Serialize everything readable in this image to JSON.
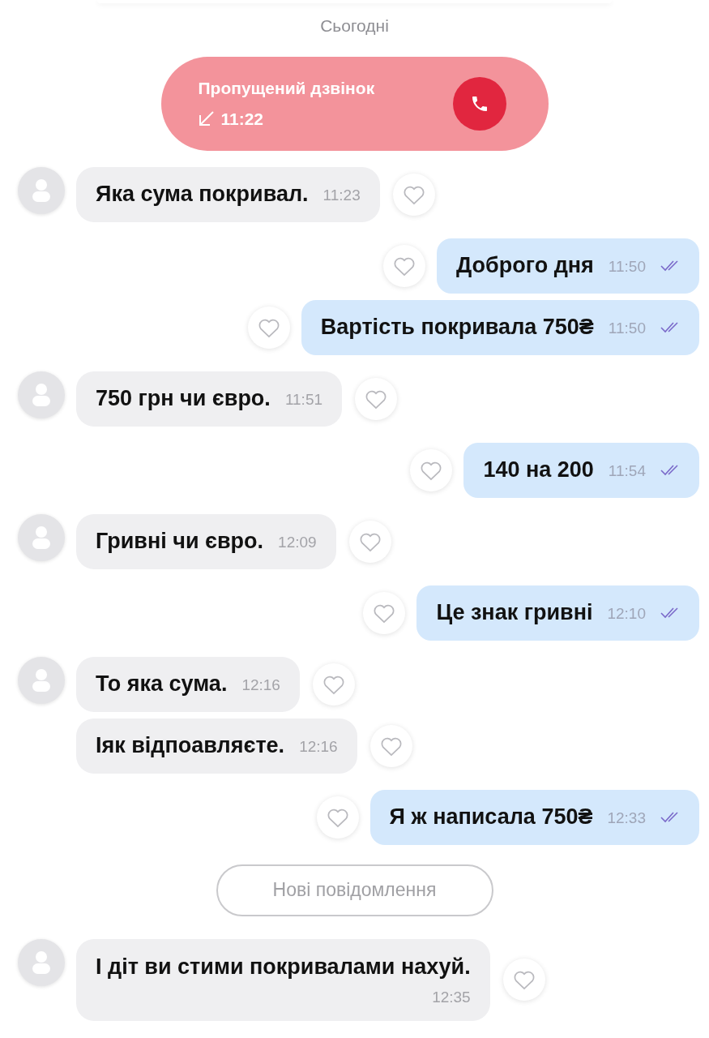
{
  "date_divider": "Сьогодні",
  "missed_call": {
    "title": "Пропущений дзвінок",
    "time": "11:22"
  },
  "messages": [
    {
      "kind": "incoming",
      "avatar": true,
      "text": "Яка сума покривал.",
      "time": "11:23"
    },
    {
      "kind": "outgoing",
      "read": true,
      "text": "Доброго дня",
      "time": "11:50"
    },
    {
      "kind": "outgoing",
      "read": true,
      "text": "Вартість покривала 750₴",
      "time": "11:50"
    },
    {
      "kind": "incoming",
      "avatar": true,
      "text": "750 грн чи євро.",
      "time": "11:51"
    },
    {
      "kind": "outgoing",
      "read": true,
      "text": "140 на 200",
      "time": "11:54"
    },
    {
      "kind": "incoming",
      "avatar": true,
      "text": "Гривні чи євро.",
      "time": "12:09"
    },
    {
      "kind": "outgoing",
      "read": true,
      "text": "Це знак гривні",
      "time": "12:10"
    },
    {
      "kind": "incoming",
      "avatar": true,
      "text": "То яка сума.",
      "time": "12:16"
    },
    {
      "kind": "incoming",
      "avatar": false,
      "text": "Іяк відпоавляєте.",
      "time": "12:16"
    },
    {
      "kind": "outgoing",
      "read": true,
      "text": "Я ж написала 750₴",
      "time": "12:33"
    },
    {
      "kind": "divider",
      "text": "Нові повідомлення"
    },
    {
      "kind": "incoming",
      "avatar": true,
      "time_below": true,
      "text": "І діт ви стими покривалами нахуй.",
      "time": "12:35"
    }
  ]
}
